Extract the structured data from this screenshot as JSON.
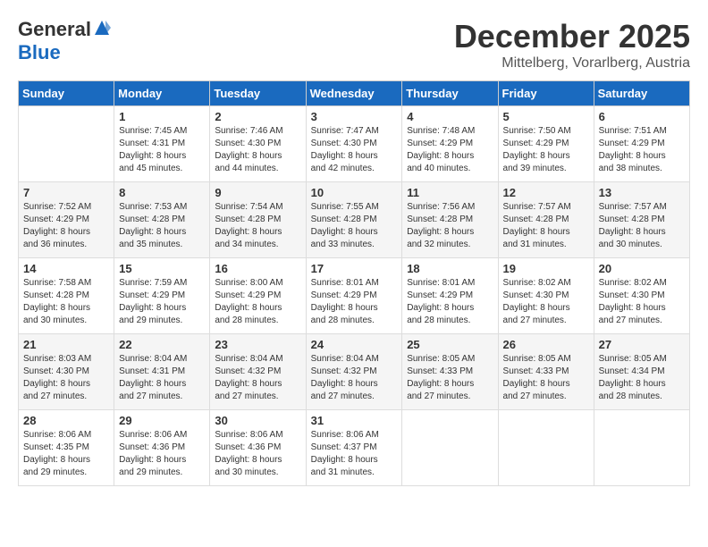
{
  "header": {
    "logo_general": "General",
    "logo_blue": "Blue",
    "title": "December 2025",
    "location": "Mittelberg, Vorarlberg, Austria"
  },
  "calendar": {
    "days_of_week": [
      "Sunday",
      "Monday",
      "Tuesday",
      "Wednesday",
      "Thursday",
      "Friday",
      "Saturday"
    ],
    "weeks": [
      [
        {
          "day": "",
          "content": ""
        },
        {
          "day": "1",
          "content": "Sunrise: 7:45 AM\nSunset: 4:31 PM\nDaylight: 8 hours\nand 45 minutes."
        },
        {
          "day": "2",
          "content": "Sunrise: 7:46 AM\nSunset: 4:30 PM\nDaylight: 8 hours\nand 44 minutes."
        },
        {
          "day": "3",
          "content": "Sunrise: 7:47 AM\nSunset: 4:30 PM\nDaylight: 8 hours\nand 42 minutes."
        },
        {
          "day": "4",
          "content": "Sunrise: 7:48 AM\nSunset: 4:29 PM\nDaylight: 8 hours\nand 40 minutes."
        },
        {
          "day": "5",
          "content": "Sunrise: 7:50 AM\nSunset: 4:29 PM\nDaylight: 8 hours\nand 39 minutes."
        },
        {
          "day": "6",
          "content": "Sunrise: 7:51 AM\nSunset: 4:29 PM\nDaylight: 8 hours\nand 38 minutes."
        }
      ],
      [
        {
          "day": "7",
          "content": "Sunrise: 7:52 AM\nSunset: 4:29 PM\nDaylight: 8 hours\nand 36 minutes."
        },
        {
          "day": "8",
          "content": "Sunrise: 7:53 AM\nSunset: 4:28 PM\nDaylight: 8 hours\nand 35 minutes."
        },
        {
          "day": "9",
          "content": "Sunrise: 7:54 AM\nSunset: 4:28 PM\nDaylight: 8 hours\nand 34 minutes."
        },
        {
          "day": "10",
          "content": "Sunrise: 7:55 AM\nSunset: 4:28 PM\nDaylight: 8 hours\nand 33 minutes."
        },
        {
          "day": "11",
          "content": "Sunrise: 7:56 AM\nSunset: 4:28 PM\nDaylight: 8 hours\nand 32 minutes."
        },
        {
          "day": "12",
          "content": "Sunrise: 7:57 AM\nSunset: 4:28 PM\nDaylight: 8 hours\nand 31 minutes."
        },
        {
          "day": "13",
          "content": "Sunrise: 7:57 AM\nSunset: 4:28 PM\nDaylight: 8 hours\nand 30 minutes."
        }
      ],
      [
        {
          "day": "14",
          "content": "Sunrise: 7:58 AM\nSunset: 4:28 PM\nDaylight: 8 hours\nand 30 minutes."
        },
        {
          "day": "15",
          "content": "Sunrise: 7:59 AM\nSunset: 4:29 PM\nDaylight: 8 hours\nand 29 minutes."
        },
        {
          "day": "16",
          "content": "Sunrise: 8:00 AM\nSunset: 4:29 PM\nDaylight: 8 hours\nand 28 minutes."
        },
        {
          "day": "17",
          "content": "Sunrise: 8:01 AM\nSunset: 4:29 PM\nDaylight: 8 hours\nand 28 minutes."
        },
        {
          "day": "18",
          "content": "Sunrise: 8:01 AM\nSunset: 4:29 PM\nDaylight: 8 hours\nand 28 minutes."
        },
        {
          "day": "19",
          "content": "Sunrise: 8:02 AM\nSunset: 4:30 PM\nDaylight: 8 hours\nand 27 minutes."
        },
        {
          "day": "20",
          "content": "Sunrise: 8:02 AM\nSunset: 4:30 PM\nDaylight: 8 hours\nand 27 minutes."
        }
      ],
      [
        {
          "day": "21",
          "content": "Sunrise: 8:03 AM\nSunset: 4:30 PM\nDaylight: 8 hours\nand 27 minutes."
        },
        {
          "day": "22",
          "content": "Sunrise: 8:04 AM\nSunset: 4:31 PM\nDaylight: 8 hours\nand 27 minutes."
        },
        {
          "day": "23",
          "content": "Sunrise: 8:04 AM\nSunset: 4:32 PM\nDaylight: 8 hours\nand 27 minutes."
        },
        {
          "day": "24",
          "content": "Sunrise: 8:04 AM\nSunset: 4:32 PM\nDaylight: 8 hours\nand 27 minutes."
        },
        {
          "day": "25",
          "content": "Sunrise: 8:05 AM\nSunset: 4:33 PM\nDaylight: 8 hours\nand 27 minutes."
        },
        {
          "day": "26",
          "content": "Sunrise: 8:05 AM\nSunset: 4:33 PM\nDaylight: 8 hours\nand 27 minutes."
        },
        {
          "day": "27",
          "content": "Sunrise: 8:05 AM\nSunset: 4:34 PM\nDaylight: 8 hours\nand 28 minutes."
        }
      ],
      [
        {
          "day": "28",
          "content": "Sunrise: 8:06 AM\nSunset: 4:35 PM\nDaylight: 8 hours\nand 29 minutes."
        },
        {
          "day": "29",
          "content": "Sunrise: 8:06 AM\nSunset: 4:36 PM\nDaylight: 8 hours\nand 29 minutes."
        },
        {
          "day": "30",
          "content": "Sunrise: 8:06 AM\nSunset: 4:36 PM\nDaylight: 8 hours\nand 30 minutes."
        },
        {
          "day": "31",
          "content": "Sunrise: 8:06 AM\nSunset: 4:37 PM\nDaylight: 8 hours\nand 31 minutes."
        },
        {
          "day": "",
          "content": ""
        },
        {
          "day": "",
          "content": ""
        },
        {
          "day": "",
          "content": ""
        }
      ]
    ]
  }
}
